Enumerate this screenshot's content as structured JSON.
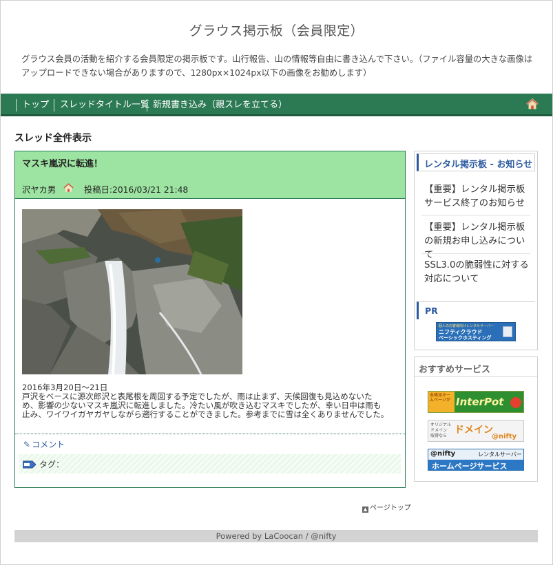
{
  "header": {
    "site_title": "グラウス掲示板（会員限定）",
    "description": "グラウス会員の活動を紹介する会員限定の掲示板です。山行報告、山の情報等自由に書き込んで下さい。（ファイル容量の大きな画像はアップロードできない場合がありますので、1280px×1024px以下の画像をお勧めします）"
  },
  "nav": {
    "items": [
      {
        "label": "トップ"
      },
      {
        "label": "スレッドタイトル一覧"
      },
      {
        "label": "新規書き込み（親スレを立てる）"
      }
    ],
    "home_icon": "home-icon"
  },
  "main": {
    "section_title": "スレッド全件表示",
    "thread": {
      "title": "マスキ嵐沢に転進！",
      "author": "沢ヤカ男",
      "posted": "投稿日:2016/03/21 21:48",
      "body_lines": [
        "2016年3月20日～21日",
        "戸沢をベースに源次郎沢と表尾根を周回する予定でしたが、雨は止まず、天候回復も見込めないた",
        "め、影響の少ないマスキ嵐沢に転進しました。冷たい風が吹き込むマスキでしたが、幸い日中は雨も",
        "止み、ワイワイガヤガヤしながら遡行することができました。参考までに雪は全くありませんでした。"
      ],
      "comment_label": "コメント",
      "tag_label": "タグ："
    },
    "page_top_label": "ページトップ"
  },
  "sidebar": {
    "notice_title": "レンタル掲示板 - お知らせ",
    "notices": [
      "【重要】レンタル掲示板サービス終了のお知らせ",
      "【重要】レンタル掲示板の新規お申し込みについて",
      "SSL3.0の脆弱性に対する対応について"
    ],
    "pr_title": "PR",
    "pr_banner": {
      "line1": "個人のお客様向けレンタルサーバー",
      "line2": "ニフティクラウド",
      "line3": "ベーシックホスティング"
    },
    "recommend_title": "おすすめサービス",
    "banners": {
      "interpot": {
        "small": "本格派ホームページが",
        "main": "InterPot"
      },
      "domain": {
        "small1": "オリジナル",
        "small2": "ドメイン",
        "small3": "取得なら",
        "main": "ドメイン",
        "brand": "@nifty"
      },
      "homepage": {
        "brand": "@nifty",
        "sub": "レンタルサーバー",
        "main": "ホームページサービス"
      }
    }
  },
  "footer": {
    "text": "Powered by LaCoocan / @nifty"
  },
  "colors": {
    "nav_green": "#2c7a53",
    "thread_head_green": "#9de3a1",
    "link_blue": "#2c5aa0",
    "footer_gray": "#d3d3d3"
  }
}
